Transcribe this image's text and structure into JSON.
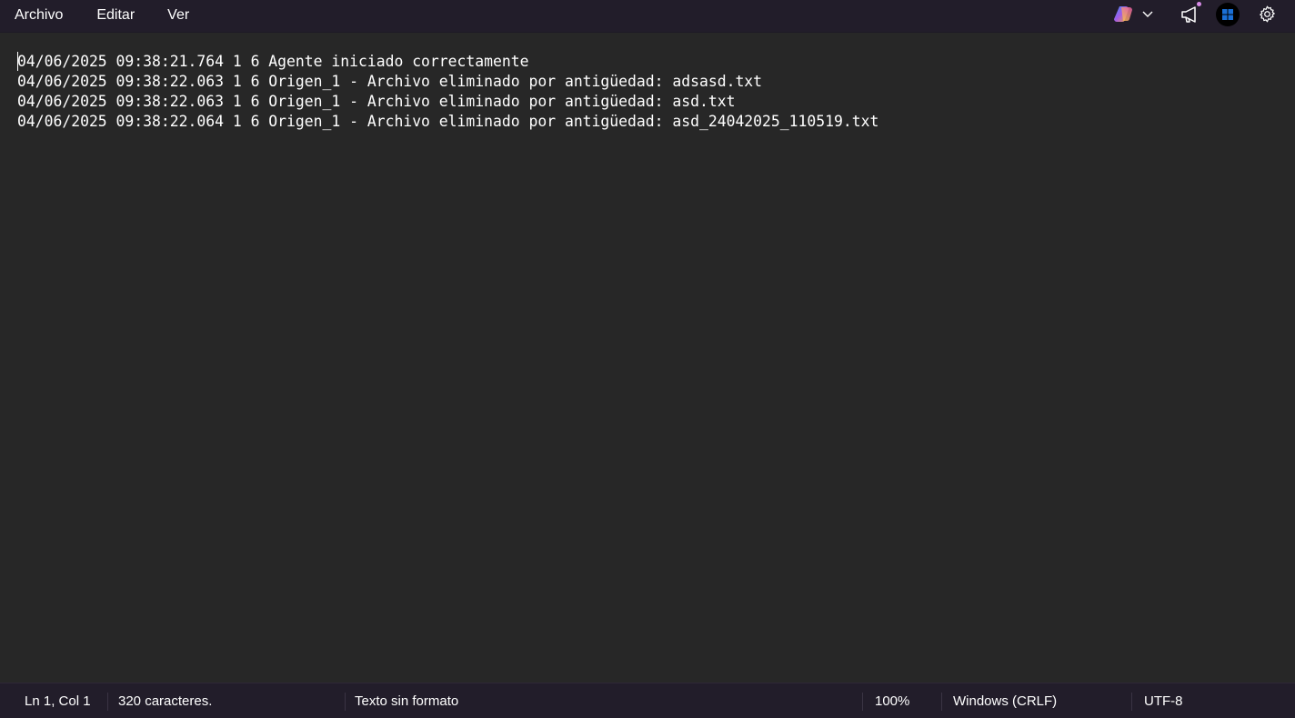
{
  "menu": {
    "items": [
      "Archivo",
      "Editar",
      "Ver"
    ]
  },
  "toolbar": {
    "icons": [
      "copilot-icon",
      "chevron-down-icon",
      "megaphone-icon",
      "account-icon",
      "gear-icon"
    ]
  },
  "editor": {
    "lines": [
      "04/06/2025 09:38:21.764 1 6 Agente iniciado correctamente",
      "04/06/2025 09:38:22.063 1 6 Origen_1 - Archivo eliminado por antigüedad: adsasd.txt",
      "04/06/2025 09:38:22.063 1 6 Origen_1 - Archivo eliminado por antigüedad: asd.txt",
      "04/06/2025 09:38:22.064 1 6 Origen_1 - Archivo eliminado por antigüedad: asd_24042025_110519.txt"
    ]
  },
  "status": {
    "position": "Ln 1, Col 1",
    "chars": "320 caracteres.",
    "format": "Texto sin formato",
    "zoom": "100%",
    "line_ending": "Windows (CRLF)",
    "encoding": "UTF-8"
  },
  "colors": {
    "menubar_bg": "#221d2a",
    "editor_bg": "#272727",
    "text": "#ffffff"
  }
}
